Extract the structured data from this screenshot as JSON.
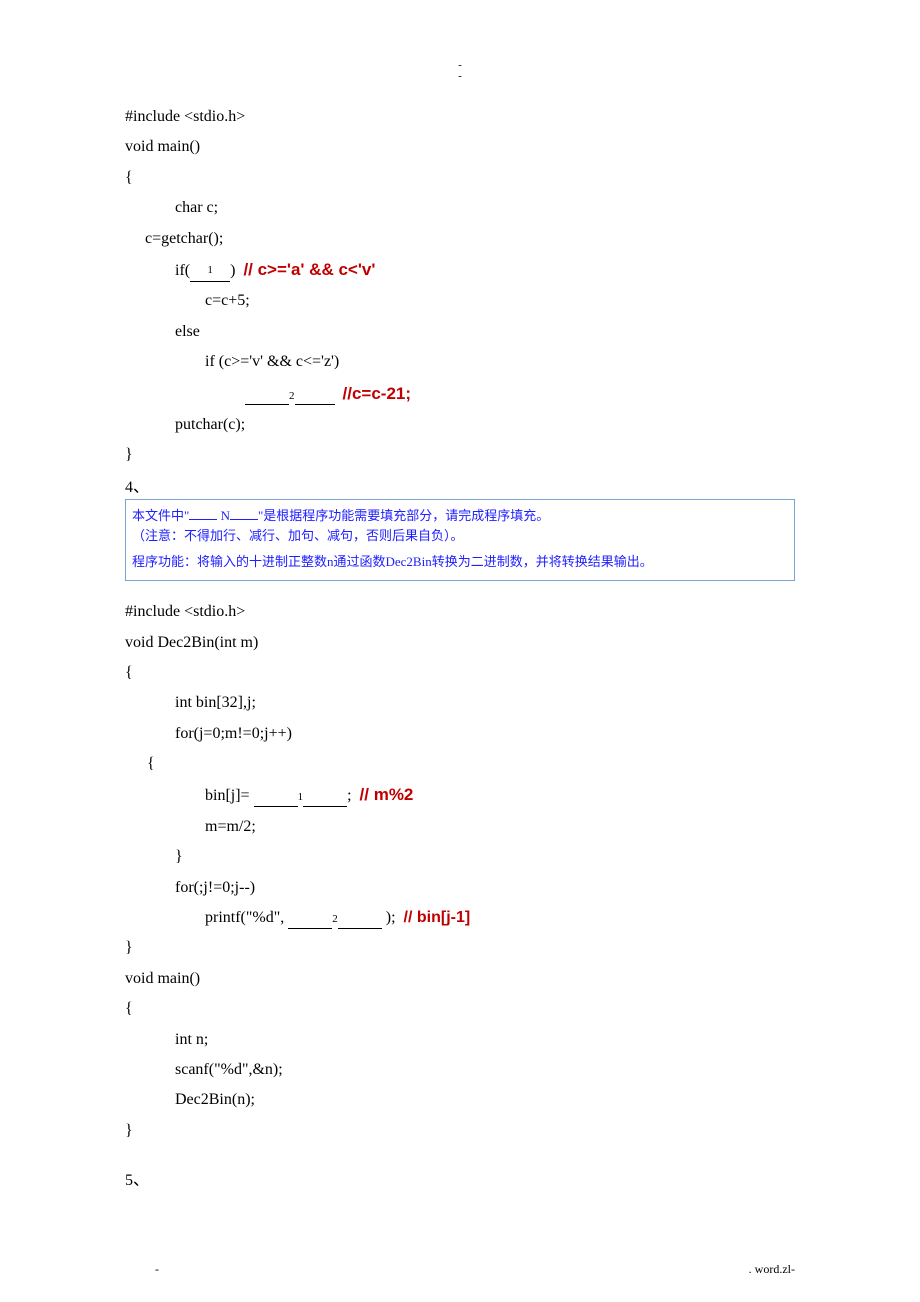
{
  "header": {
    "dash1": "-",
    "dash2": "-"
  },
  "block1": {
    "l1": "#include <stdio.h>",
    "l2": "void main()",
    "l3": "{",
    "l4": "char c;",
    "l5": "c=getchar();",
    "l6a": "if(",
    "l6blank": "1",
    "l6b": ")",
    "l6ann": "// c>='a' && c<'v'",
    "l7": "c=c+5;",
    "l8": "else",
    "l9": "if (c>='v' && c<='z')",
    "l10blank": "2",
    "l10ann": "//c=c-21;",
    "l11": "putchar(c);",
    "l12": "}"
  },
  "sec4": "4、",
  "instruction": {
    "ln1a": "本文件中\"",
    "ln1mid": "N",
    "ln1b": "\"是根据程序功能需要填充部分，请完成程序填充。",
    "ln2": "（注意：不得加行、减行、加句、减句，否则后果自负）。",
    "ln3": "程序功能：将输入的十进制正整数n通过函数Dec2Bin转换为二进制数，并将转换结果输出。"
  },
  "block2": {
    "l1": "#include <stdio.h>",
    "l2": "void Dec2Bin(int m)",
    "l3": "{",
    "l4": "int bin[32],j;",
    "l5": "for(j=0;m!=0;j++)",
    "l6": "{",
    "l7a": "bin[j]= ",
    "l7blank": "1",
    "l7b": ";",
    "l7ann": "// m%2",
    "l8": "m=m/2;",
    "l9": "}",
    "l10": "for(;j!=0;j--)",
    "l11a": "printf(\"%d\", ",
    "l11blank": "2",
    "l11b": " );",
    "l11ann": "//   bin[j-1]",
    "l12": "}",
    "l13": "void main()",
    "l14": "{",
    "l15": "int n;",
    "l16": "scanf(\"%d\",&n);",
    "l17": "Dec2Bin(n);",
    "l18": "}"
  },
  "sec5": "5、",
  "footer": {
    "left": "-",
    "right": ". word.zl-"
  }
}
